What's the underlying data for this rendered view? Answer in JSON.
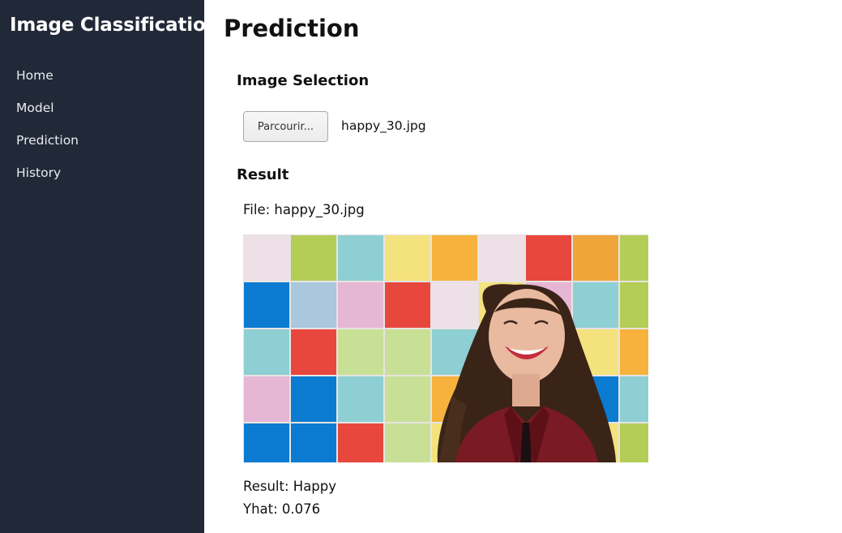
{
  "sidebar": {
    "title": "Image Classification",
    "items": [
      {
        "label": "Home"
      },
      {
        "label": "Model"
      },
      {
        "label": "Prediction"
      },
      {
        "label": "History"
      }
    ]
  },
  "main": {
    "title": "Prediction",
    "selection": {
      "heading": "Image Selection",
      "browse_label": "Parcourir...",
      "selected_file": "happy_30.jpg"
    },
    "result": {
      "heading": "Result",
      "file_line": "File: happy_30.jpg",
      "result_line": "Result: Happy",
      "yhat_line": "Yhat: 0.076",
      "image_description": "smiling-woman-colorful-tiles-photo"
    }
  },
  "colors": {
    "sidebar_bg": "#212938",
    "sidebar_text": "#e9ecf1",
    "page_bg": "#ffffff"
  }
}
